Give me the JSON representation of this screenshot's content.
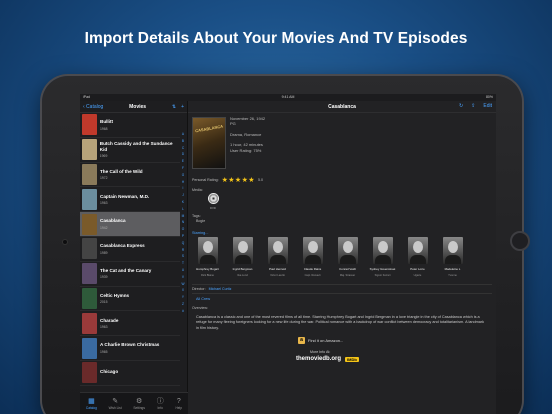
{
  "headline": "Import Details About Your Movies And TV Episodes",
  "status": {
    "left": "iPad",
    "time": "9:41 AM",
    "battery": "80%"
  },
  "sidebar": {
    "back": "‹ Catalog",
    "title": "Movies",
    "sort": "⇅",
    "add": "+",
    "items": [
      {
        "title": "Bullitt",
        "year": "1968",
        "color": "#c0392b"
      },
      {
        "title": "Butch Cassidy and the Sundance Kid",
        "year": "1969",
        "color": "#b7a37a"
      },
      {
        "title": "The Call of the Wild",
        "year": "1972",
        "color": "#8a7a5a"
      },
      {
        "title": "Captain Newman, M.D.",
        "year": "1963",
        "color": "#6b8e9e"
      },
      {
        "title": "Casablanca",
        "year": "1942",
        "color": "#7a5a2a"
      },
      {
        "title": "Casablanca Express",
        "year": "1989",
        "color": "#444"
      },
      {
        "title": "The Cat and the Canary",
        "year": "1939",
        "color": "#5a4a6a"
      },
      {
        "title": "Celtic Hymns",
        "year": "2015",
        "color": "#2e5a3a"
      },
      {
        "title": "Charade",
        "year": "1963",
        "color": "#9a3a3a"
      },
      {
        "title": "A Charlie Brown Christmas",
        "year": "1965",
        "color": "#3a6aa0"
      },
      {
        "title": "Chicago",
        "year": "",
        "color": "#6a2a2a"
      }
    ],
    "index": [
      "A",
      "B",
      "C",
      "D",
      "E",
      "F",
      "G",
      "H",
      "I",
      "J",
      "K",
      "L",
      "M",
      "N",
      "O",
      "P",
      "Q",
      "R",
      "S",
      "T",
      "U",
      "V",
      "W",
      "X",
      "Y",
      "Z",
      "#"
    ],
    "tabs": [
      {
        "icon": "▦",
        "label": "Catalog"
      },
      {
        "icon": "✎",
        "label": "Wish List"
      },
      {
        "icon": "⚙",
        "label": "Settings"
      },
      {
        "icon": "ⓘ",
        "label": "Info"
      },
      {
        "icon": "?",
        "label": "Help"
      }
    ]
  },
  "detail": {
    "title": "Casablanca",
    "refresh": "↻",
    "share": "⇪",
    "edit": "Edit",
    "poster_text": "CASABLANCA",
    "date": "November 26, 1942",
    "rating_code": "PG",
    "genre": "Drama, Romance",
    "runtime": "1 hour, 42 minutes",
    "user_rating": "User Rating: 75%",
    "personal_rating_label": "Personal Rating:",
    "stars": "★★★★★",
    "stars_value": "5.0",
    "media_label": "Media:",
    "media": "DVD",
    "tags_label": "Tags:",
    "tag": "Bogie",
    "starring": "Starring...",
    "cast": [
      {
        "name": "Humphrey Bogart",
        "role": "Rick Blaine"
      },
      {
        "name": "Ingrid Bergman",
        "role": "Ilsa Lund"
      },
      {
        "name": "Paul Henreid",
        "role": "Victor Laszlo"
      },
      {
        "name": "Claude Rains",
        "role": "Capt. Renault"
      },
      {
        "name": "Conrad Veidt",
        "role": "Maj. Strasser"
      },
      {
        "name": "Sydney Greenstreet",
        "role": "Signor Ferrari"
      },
      {
        "name": "Peter Lorre",
        "role": "Ugarte"
      },
      {
        "name": "Madeleine L",
        "role": "Yvonne"
      }
    ],
    "director_label": "Director:",
    "director": "Michael Curtiz",
    "all_crew": "All Crew",
    "overview_label": "Overview:",
    "overview": "Casablanca is a classic and one of the most revered films of all time. Starring Humphrey Bogart and Ingrid Bergman in a love triangle in the city of Casablanca which is a refuge for many fleeing foreigners looking for a new life during the war. Political romance with a backdrop of war conflict between democracy and totalitarianism. A landmark in film history.",
    "amazon_icon": "a",
    "amazon": "Find it on Amazon...",
    "more_info": "More Info At:",
    "tmdb": "themoviedb.org",
    "imdb": "IMDb"
  }
}
